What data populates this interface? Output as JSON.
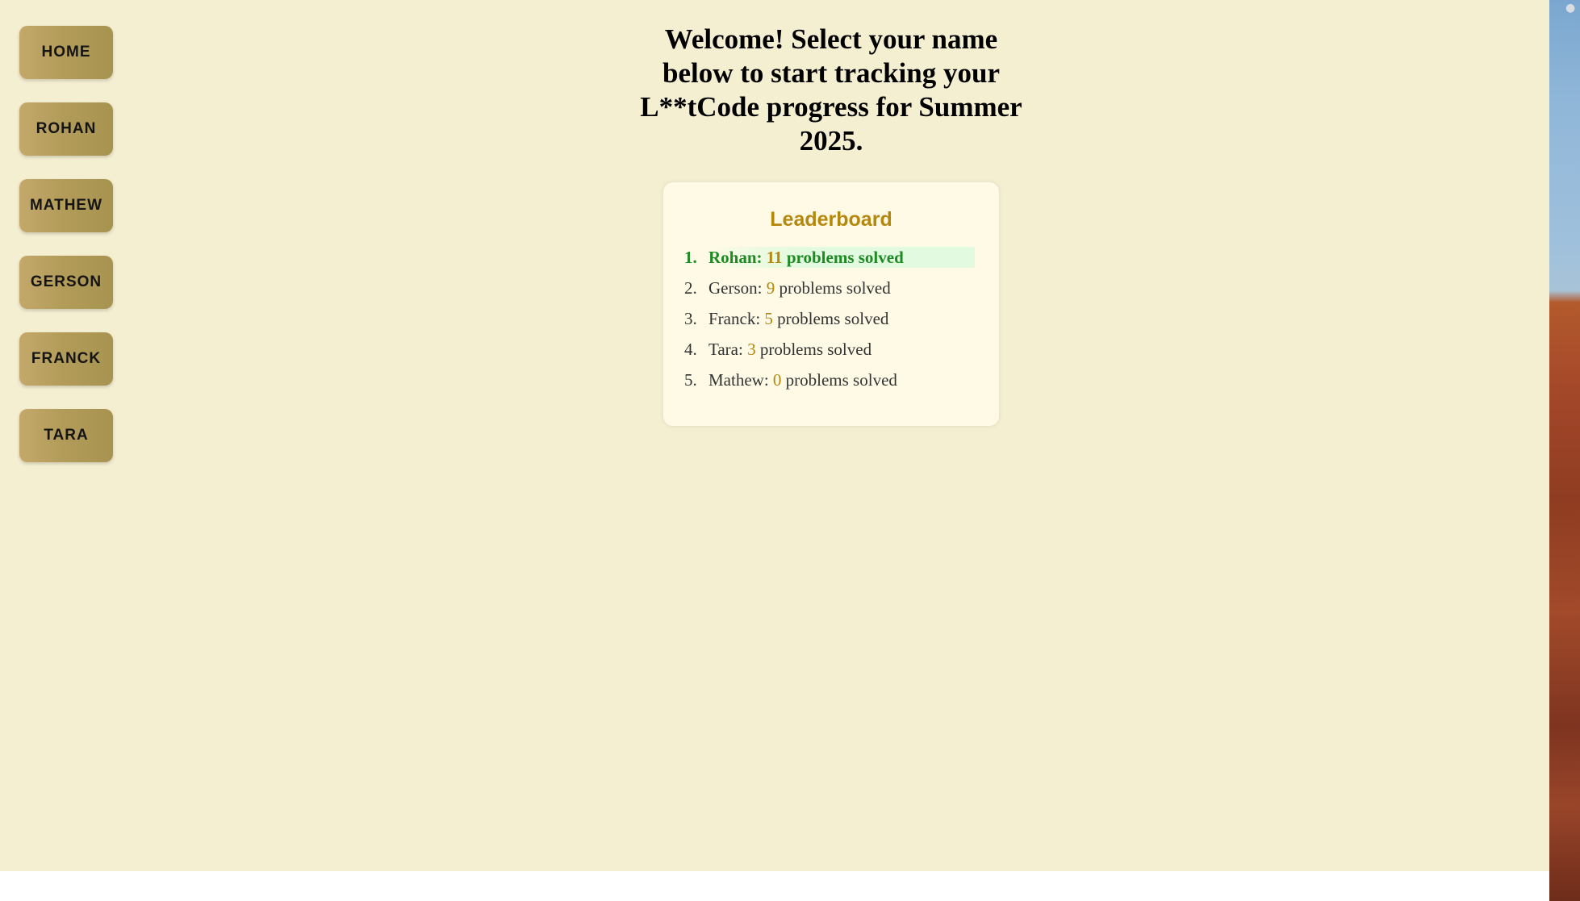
{
  "sidebar": {
    "items": [
      {
        "label": "HOME"
      },
      {
        "label": "ROHAN"
      },
      {
        "label": "MATHEW"
      },
      {
        "label": "GERSON"
      },
      {
        "label": "FRANCK"
      },
      {
        "label": "TARA"
      }
    ]
  },
  "main": {
    "headline": "Welcome! Select your name below to start tracking your L**tCode progress for Summer 2025."
  },
  "leaderboard": {
    "title": "Leaderboard",
    "suffix": " problems solved",
    "entries": [
      {
        "rank": "1.",
        "name": "Rohan:",
        "count": "11"
      },
      {
        "rank": "2.",
        "name": "Gerson:",
        "count": "9"
      },
      {
        "rank": "3.",
        "name": "Franck:",
        "count": "5"
      },
      {
        "rank": "4.",
        "name": "Tara:",
        "count": "3"
      },
      {
        "rank": "5.",
        "name": "Mathew:",
        "count": "0"
      }
    ]
  },
  "colors": {
    "page_background": "#f5efd2",
    "button_gradient_start": "#c4a86a",
    "button_gradient_end": "#a79350",
    "leaderboard_background": "#fefae6",
    "accent_gold": "#b5870c",
    "leader_green": "#1f8a24",
    "leader_highlight": "#e2fadf"
  }
}
